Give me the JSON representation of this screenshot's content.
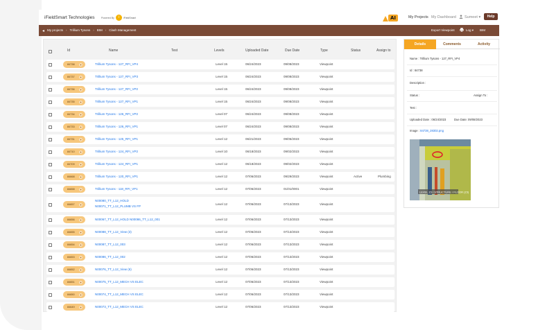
{
  "header": {
    "brand": "iFieldSmart Technologies",
    "powered_by": "Powered By",
    "powered_name": "iFieldSmart",
    "ai_logo": "AI",
    "nav_my_projects": "My Projects",
    "nav_dashboard": "My Dashboard",
    "user_name": "Sumeet",
    "help": "Help"
  },
  "breadcrumb": {
    "items": [
      "My projects",
      "Trillium Tysons",
      "BIM",
      "Clash Management"
    ],
    "export_viewpoint": "Export Viewpoint",
    "log": "Log",
    "bim": "BIM"
  },
  "table": {
    "columns": [
      "Id",
      "Name",
      "Test",
      "Levels",
      "Uploaded Date",
      "Due Date",
      "Type",
      "Status",
      "Assign to"
    ],
    "rows": [
      {
        "id": "84738",
        "name": "Trillium Tysons - 127_RFI_VP4",
        "levels": "Level 15",
        "uploaded": "06/24/2023",
        "due": "09/08/2023",
        "type": "Viewpoint",
        "status": "",
        "assign": ""
      },
      {
        "id": "84737",
        "name": "Trillium Tysons - 127_RFI_VP3",
        "levels": "Level 15",
        "uploaded": "06/24/2023",
        "due": "09/08/2023",
        "type": "Viewpoint",
        "status": "",
        "assign": ""
      },
      {
        "id": "84736",
        "name": "Trillium Tysons - 127_RFI_VP2",
        "levels": "Level 15",
        "uploaded": "06/24/2023",
        "due": "09/08/2023",
        "type": "Viewpoint",
        "status": "",
        "assign": ""
      },
      {
        "id": "84735",
        "name": "Trillium Tysons - 127_RFI_VP1",
        "levels": "Level 15",
        "uploaded": "06/24/2023",
        "due": "09/08/2023",
        "type": "Viewpoint",
        "status": "",
        "assign": ""
      },
      {
        "id": "84734",
        "name": "Trillium Tysons - 126_RFI_VP2",
        "levels": "Level 07",
        "uploaded": "06/24/2023",
        "due": "09/08/2023",
        "type": "Viewpoint",
        "status": "",
        "assign": ""
      },
      {
        "id": "84733",
        "name": "Trillium Tysons - 126_RFI_VP1",
        "levels": "Level 07",
        "uploaded": "06/24/2023",
        "due": "09/08/2023",
        "type": "Viewpoint",
        "status": "",
        "assign": ""
      },
      {
        "id": "84731",
        "name": "Trillium Tysons - 125_RFI_VP1",
        "levels": "Level 12",
        "uploaded": "06/21/2023",
        "due": "09/05/2023",
        "type": "Viewpoint",
        "status": "",
        "assign": ""
      },
      {
        "id": "84710",
        "name": "Trillium Tysons - 124_RFI_VP2",
        "levels": "Level 10",
        "uploaded": "06/18/2023",
        "due": "09/02/2023",
        "type": "Viewpoint",
        "status": "",
        "assign": ""
      },
      {
        "id": "84709",
        "name": "Trillium Tysons - 124_RFI_VP1",
        "levels": "Level 12",
        "uploaded": "06/18/2023",
        "due": "09/02/2023",
        "type": "Viewpoint",
        "status": "",
        "assign": ""
      },
      {
        "id": "84668",
        "name": "Trillium Tysons - 120_RFI_VP1",
        "levels": "Level 12",
        "uploaded": "07/06/2023",
        "due": "09/29/2023",
        "type": "Viewpoint",
        "status": "Active",
        "assign": "Plumbing"
      },
      {
        "id": "84658",
        "name": "Trillium Tysons - 118_RFI_VP1",
        "levels": "Level 12",
        "uploaded": "07/06/2023",
        "due": "01/01/0001",
        "type": "Viewpoint",
        "status": "",
        "assign": ""
      },
      {
        "id": "84657",
        "name": "N00080_TT_L12_HOLD",
        "name2": "N00071_TT_L12_PLUMB VS FP",
        "levels": "Level 12",
        "uploaded": "07/06/2023",
        "due": "07/13/2023",
        "type": "Viewpoint",
        "status": "",
        "assign": ""
      },
      {
        "id": "84656",
        "name": "N00067_TT_L12_HOLD N00086_TT_L12_001",
        "levels": "Level 12",
        "uploaded": "07/06/2023",
        "due": "07/13/2023",
        "type": "Viewpoint",
        "status": "",
        "assign": ""
      },
      {
        "id": "84655",
        "name": "N00088_TT_L12_View (3)",
        "levels": "Level 12",
        "uploaded": "07/06/2023",
        "due": "07/13/2023",
        "type": "Viewpoint",
        "status": "",
        "assign": ""
      },
      {
        "id": "84654",
        "name": "N00087_TT_L12_003",
        "levels": "Level 12",
        "uploaded": "07/06/2023",
        "due": "07/13/2023",
        "type": "Viewpoint",
        "status": "",
        "assign": ""
      },
      {
        "id": "84653",
        "name": "N00086_TT_L12_002",
        "levels": "Level 12",
        "uploaded": "07/06/2023",
        "due": "07/13/2023",
        "type": "Viewpoint",
        "status": "",
        "assign": ""
      },
      {
        "id": "84652",
        "name": "N00076_TT_L12_View (6)",
        "levels": "Level 12",
        "uploaded": "07/06/2023",
        "due": "07/13/2023",
        "type": "Viewpoint",
        "status": "",
        "assign": ""
      },
      {
        "id": "84651",
        "name": "N00075_TT_L12_MECH VS ELEC",
        "levels": "Level 12",
        "uploaded": "07/06/2023",
        "due": "07/13/2023",
        "type": "Viewpoint",
        "status": "",
        "assign": ""
      },
      {
        "id": "84650",
        "name": "N00074_TT_L12_MECH VS ELEC",
        "levels": "Level 12",
        "uploaded": "07/06/2023",
        "due": "07/13/2023",
        "type": "Viewpoint",
        "status": "",
        "assign": ""
      },
      {
        "id": "84649",
        "name": "N00073_TT_L12_MECH VS ELEC",
        "levels": "Level 12",
        "uploaded": "07/06/2023",
        "due": "07/13/2023",
        "type": "Viewpoint",
        "status": "",
        "assign": ""
      }
    ]
  },
  "detail": {
    "tabs": [
      "Details",
      "Comments",
      "Activity"
    ],
    "name": "Name : Trillium Tysons - 127_RFI_VP4",
    "id": "Id : 84738",
    "description": "Description :",
    "status": "Status :",
    "assign_to": "Assign To :",
    "test": "Test :",
    "uploaded_date": "Uploaded Date : 06/24/2023",
    "due_date": "Due Date: 09/08/2023",
    "image_label": "Image :",
    "image_name": "84738_28302.png",
    "preview_caption": "LEVEL 15 / STRUCTURE / FLOOR (15)"
  },
  "colors": {
    "accent": "#f5a623",
    "crumb_bar": "#7a4a36",
    "link": "#1a73e8",
    "id_pill": "#f7c77c"
  }
}
